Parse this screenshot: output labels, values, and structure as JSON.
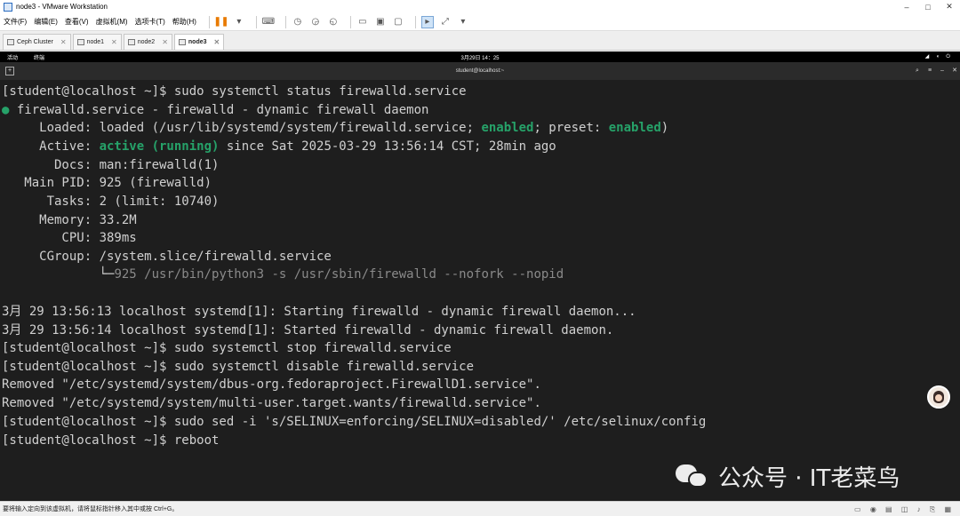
{
  "window": {
    "title": "node3 - VMware Workstation",
    "minimize": "–",
    "maximize": "□",
    "close": "✕"
  },
  "menu": {
    "items": [
      "文件(F)",
      "编辑(E)",
      "查看(V)",
      "虚拟机(M)",
      "选项卡(T)",
      "帮助(H)"
    ]
  },
  "tabs": [
    {
      "label": "Ceph Cluster"
    },
    {
      "label": "node1"
    },
    {
      "label": "node2"
    },
    {
      "label": "node3"
    }
  ],
  "tab_close": "✕",
  "gnome": {
    "activities": "活动",
    "app": "终端",
    "clock": "3月29日 14：25"
  },
  "terminal_header": {
    "title": "student@localhost:~",
    "newtab": "+",
    "search": "⌕",
    "menu": "≡",
    "minimize": "–",
    "close": "✕"
  },
  "terminal": {
    "lines": [
      {
        "text": "[student@localhost ~]$ sudo systemctl status firewalld.service"
      },
      {
        "bullet": "●",
        "text": " firewalld.service - firewalld - dynamic firewall daemon"
      },
      {
        "pre": "     Loaded: loaded (/usr/lib/systemd/system/firewalld.service; ",
        "g1": "enabled",
        "mid": "; preset: ",
        "g2": "enabled",
        "post": ")"
      },
      {
        "pre": "     Active: ",
        "g1": "active (running)",
        "post": " since Sat 2025-03-29 13:56:14 CST; 28min ago"
      },
      {
        "text": "       Docs: man:firewalld(1)"
      },
      {
        "text": "   Main PID: 925 (firewalld)"
      },
      {
        "text": "      Tasks: 2 (limit: 10740)"
      },
      {
        "text": "     Memory: 33.2M"
      },
      {
        "text": "        CPU: 389ms"
      },
      {
        "text": "     CGroup: /system.slice/firewalld.service"
      },
      {
        "tree": "             └─",
        "dim": "925 /usr/bin/python3 -s /usr/sbin/firewalld --nofork --nopid"
      },
      {
        "text": ""
      },
      {
        "text": "3月 29 13:56:13 localhost systemd[1]: Starting firewalld - dynamic firewall daemon..."
      },
      {
        "text": "3月 29 13:56:14 localhost systemd[1]: Started firewalld - dynamic firewall daemon."
      },
      {
        "text": "[student@localhost ~]$ sudo systemctl stop firewalld.service"
      },
      {
        "text": "[student@localhost ~]$ sudo systemctl disable firewalld.service"
      },
      {
        "text": "Removed \"/etc/systemd/system/dbus-org.fedoraproject.FirewallD1.service\"."
      },
      {
        "text": "Removed \"/etc/systemd/system/multi-user.target.wants/firewalld.service\"."
      },
      {
        "text": "[student@localhost ~]$ sudo sed -i 's/SELINUX=enforcing/SELINUX=disabled/' /etc/selinux/config"
      },
      {
        "text": "[student@localhost ~]$ reboot"
      }
    ]
  },
  "watermark": {
    "text": "公众号 · IT老菜鸟"
  },
  "status": {
    "text": "要将输入定向到该虚拟机，请将鼠标指针移入其中或按 Ctrl+G。"
  }
}
